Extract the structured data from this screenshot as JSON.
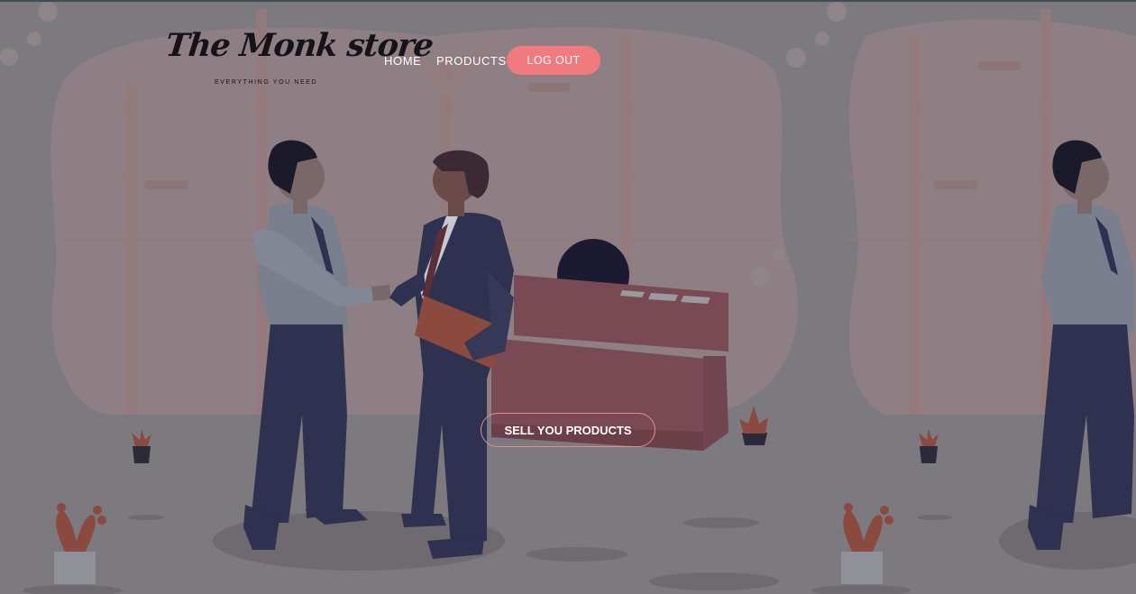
{
  "brand": {
    "name": "The Monk store",
    "tagline": "EVERYTHING YOU NEED"
  },
  "nav": {
    "home": "HOME",
    "products": "PRODUCTS",
    "logout": "LOG OUT"
  },
  "hero": {
    "cta": "SELL YOU PRODUCTS",
    "illustration": "business-handshake-illustration"
  },
  "colors": {
    "overlay_bg": "#7c7a7e",
    "accent": "#f07a7d",
    "cta_border": "#e78b8c",
    "suit_dark": "#2f3150",
    "desk": "#7a4a54"
  }
}
